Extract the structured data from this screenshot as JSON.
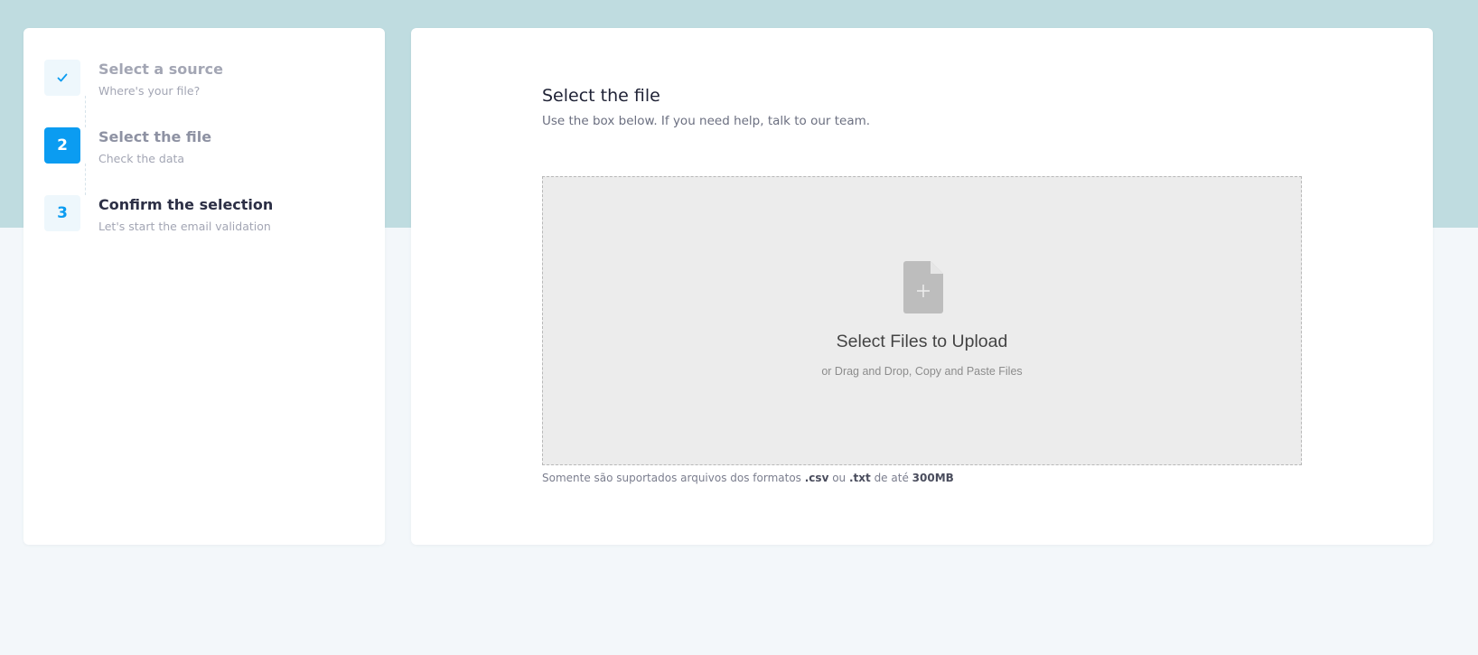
{
  "stepper": {
    "steps": [
      {
        "number": "✓",
        "title": "Select a source",
        "subtitle": "Where's your file?",
        "state": "done"
      },
      {
        "number": "2",
        "title": "Select the file",
        "subtitle": "Check the data",
        "state": "active"
      },
      {
        "number": "3",
        "title": "Confirm the selection",
        "subtitle": "Let's start the email validation",
        "state": "pending"
      }
    ]
  },
  "main": {
    "title": "Select the file",
    "subtitle": "Use the box below. If you need help, talk to our team."
  },
  "dropzone": {
    "icon": "file-plus-icon",
    "title": "Select Files to Upload",
    "subtitle": "or Drag and Drop, Copy and Paste Files"
  },
  "note": {
    "prefix": "Somente são suportados arquivos dos formatos ",
    "format1": ".csv",
    "middle": " ou ",
    "format2": ".txt",
    "suffix": " de até ",
    "limit": "300MB"
  },
  "colors": {
    "accent": "#0b9cf1",
    "hero_band": "#bfdce0",
    "page_background": "#f3f7fa",
    "dropzone_background": "#ececec"
  }
}
